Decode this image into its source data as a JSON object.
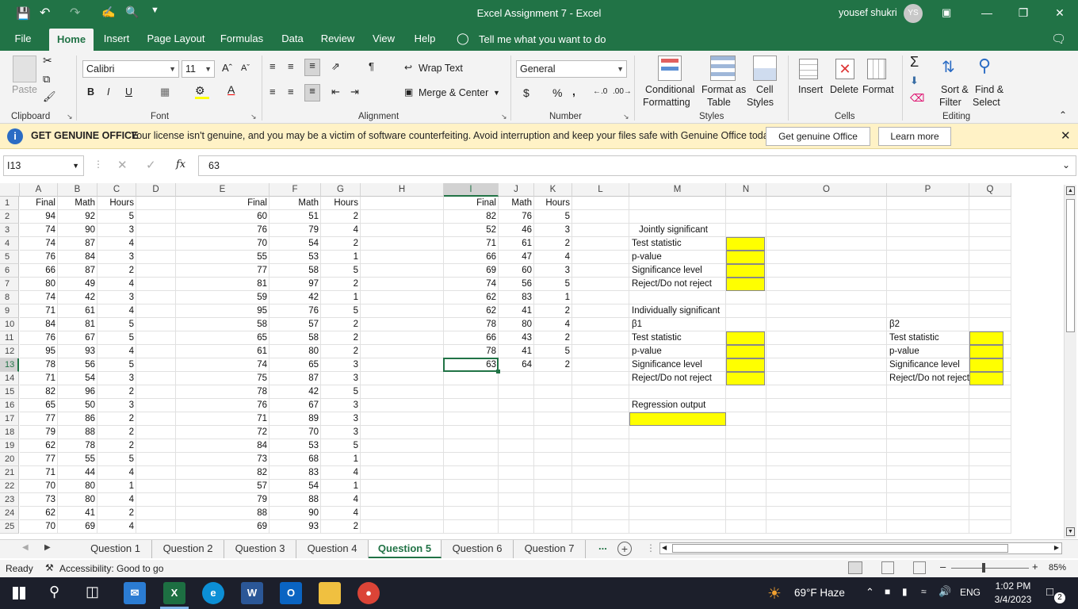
{
  "title_bar": {
    "title": "Excel Assignment 7  -  Excel",
    "user_name": "yousef shukri",
    "user_initials": "YS"
  },
  "ribbon_tabs": [
    "File",
    "Home",
    "Insert",
    "Page Layout",
    "Formulas",
    "Data",
    "Review",
    "View",
    "Help"
  ],
  "tell_me": "Tell me what you want to do",
  "ribbon": {
    "paste": "Paste",
    "clipboard": "Clipboard",
    "font_name": "Calibri",
    "font_size": "11",
    "font_group": "Font",
    "bold": "B",
    "italic": "I",
    "underline": "U",
    "wrap_text": "Wrap Text",
    "merge_center": "Merge & Center",
    "alignment_group": "Alignment",
    "number_format": "General",
    "currency": "$",
    "percent": "%",
    "comma": ",",
    "number_group": "Number",
    "conditional_formatting_1": "Conditional",
    "conditional_formatting_2": "Formatting",
    "format_as_table_1": "Format as",
    "format_as_table_2": "Table",
    "cell_styles_1": "Cell",
    "cell_styles_2": "Styles",
    "styles_group": "Styles",
    "insert": "Insert",
    "delete": "Delete",
    "format": "Format",
    "cells_group": "Cells",
    "sort_filter_1": "Sort &",
    "sort_filter_2": "Filter",
    "find_select_1": "Find &",
    "find_select_2": "Select",
    "editing_group": "Editing"
  },
  "message_bar": {
    "title": "GET GENUINE OFFICE",
    "text": "Your license isn't genuine, and you may be a victim of software counterfeiting. Avoid interruption and keep your files safe with Genuine Office today.",
    "btn1": "Get genuine Office",
    "btn2": "Learn more"
  },
  "formula_bar": {
    "name_box": "I13",
    "fx": "fx",
    "value": "63"
  },
  "columns": [
    "A",
    "B",
    "C",
    "D",
    "E",
    "F",
    "G",
    "H",
    "I",
    "J",
    "K",
    "L",
    "M",
    "N",
    "O",
    "P",
    "Q"
  ],
  "rows": [
    "1",
    "2",
    "3",
    "4",
    "5",
    "6",
    "7",
    "8",
    "9",
    "10",
    "11",
    "12",
    "13",
    "14",
    "15",
    "16",
    "17",
    "18",
    "19",
    "20",
    "21",
    "22",
    "23",
    "24",
    "25"
  ],
  "headers": {
    "final": "Final",
    "math": "Math",
    "hours": "Hours"
  },
  "table1": [
    [
      94,
      92,
      5
    ],
    [
      74,
      90,
      3
    ],
    [
      74,
      87,
      4
    ],
    [
      76,
      84,
      3
    ],
    [
      66,
      87,
      2
    ],
    [
      80,
      49,
      4
    ],
    [
      74,
      42,
      3
    ],
    [
      71,
      61,
      4
    ],
    [
      84,
      81,
      5
    ],
    [
      76,
      67,
      5
    ],
    [
      95,
      93,
      4
    ],
    [
      78,
      56,
      5
    ],
    [
      71,
      54,
      3
    ],
    [
      82,
      96,
      2
    ],
    [
      65,
      50,
      3
    ],
    [
      77,
      86,
      2
    ],
    [
      79,
      88,
      2
    ],
    [
      62,
      78,
      2
    ],
    [
      77,
      55,
      5
    ],
    [
      71,
      44,
      4
    ],
    [
      70,
      80,
      1
    ],
    [
      73,
      80,
      4
    ],
    [
      62,
      41,
      2
    ],
    [
      70,
      69,
      4
    ]
  ],
  "table2": [
    [
      60,
      51,
      2
    ],
    [
      76,
      79,
      4
    ],
    [
      70,
      54,
      2
    ],
    [
      55,
      53,
      1
    ],
    [
      77,
      58,
      5
    ],
    [
      81,
      97,
      2
    ],
    [
      59,
      42,
      1
    ],
    [
      95,
      76,
      5
    ],
    [
      58,
      57,
      2
    ],
    [
      65,
      58,
      2
    ],
    [
      61,
      80,
      2
    ],
    [
      74,
      65,
      3
    ],
    [
      75,
      87,
      3
    ],
    [
      78,
      42,
      5
    ],
    [
      76,
      67,
      3
    ],
    [
      71,
      89,
      3
    ],
    [
      72,
      70,
      3
    ],
    [
      84,
      53,
      5
    ],
    [
      73,
      68,
      1
    ],
    [
      82,
      83,
      4
    ],
    [
      57,
      54,
      1
    ],
    [
      79,
      88,
      4
    ],
    [
      88,
      90,
      4
    ],
    [
      69,
      93,
      2
    ]
  ],
  "table3": [
    [
      82,
      76,
      5
    ],
    [
      52,
      46,
      3
    ],
    [
      71,
      61,
      2
    ],
    [
      66,
      47,
      4
    ],
    [
      69,
      60,
      3
    ],
    [
      74,
      56,
      5
    ],
    [
      62,
      83,
      1
    ],
    [
      62,
      41,
      2
    ],
    [
      78,
      80,
      4
    ],
    [
      66,
      43,
      2
    ],
    [
      78,
      41,
      5
    ],
    [
      63,
      64,
      2
    ]
  ],
  "jointly": {
    "title": "Jointly significant",
    "items": [
      "Test statistic",
      "p-value",
      "Significance level",
      "Reject/Do not reject"
    ]
  },
  "individually": {
    "title": "Individually significant",
    "b1": "β1",
    "b2": "β2",
    "items": [
      "Test statistic",
      "p-value",
      "Significance level",
      "Reject/Do not reject"
    ]
  },
  "regression": "Regression output",
  "sheet_tabs": [
    "Question 1",
    "Question 2",
    "Question 3",
    "Question 4",
    "Question 5",
    "Question 6",
    "Question 7"
  ],
  "sheet_more": "...",
  "status": {
    "ready": "Ready",
    "accessibility": "Accessibility: Good to go",
    "zoom": "85%"
  },
  "taskbar": {
    "weather": "69°F  Haze",
    "lang": "ENG",
    "time": "1:02 PM",
    "date": "3/4/2023",
    "notif": "2"
  },
  "colors": {
    "excel_green": "#217346",
    "highlight_yellow": "#ffff00",
    "message_bg": "#fff2c6"
  }
}
